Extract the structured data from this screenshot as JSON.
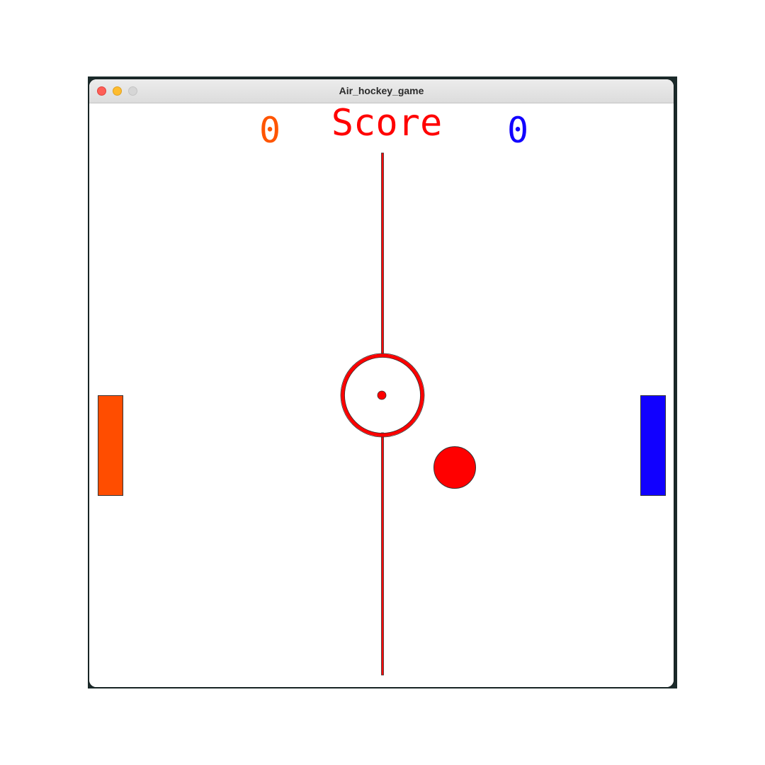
{
  "window": {
    "title": "Air_hockey_game"
  },
  "scoreboard": {
    "label": "Score",
    "left_score": "0",
    "right_score": "0",
    "label_color": "#ff0000",
    "left_color": "#ff5500",
    "right_color": "#1100ff"
  },
  "rink": {
    "line_color": "#ff0000",
    "circle_color": "#ff0000"
  },
  "paddles": {
    "left_color": "#ff4d00",
    "right_color": "#1100ff"
  },
  "puck": {
    "color": "#ff0000"
  }
}
